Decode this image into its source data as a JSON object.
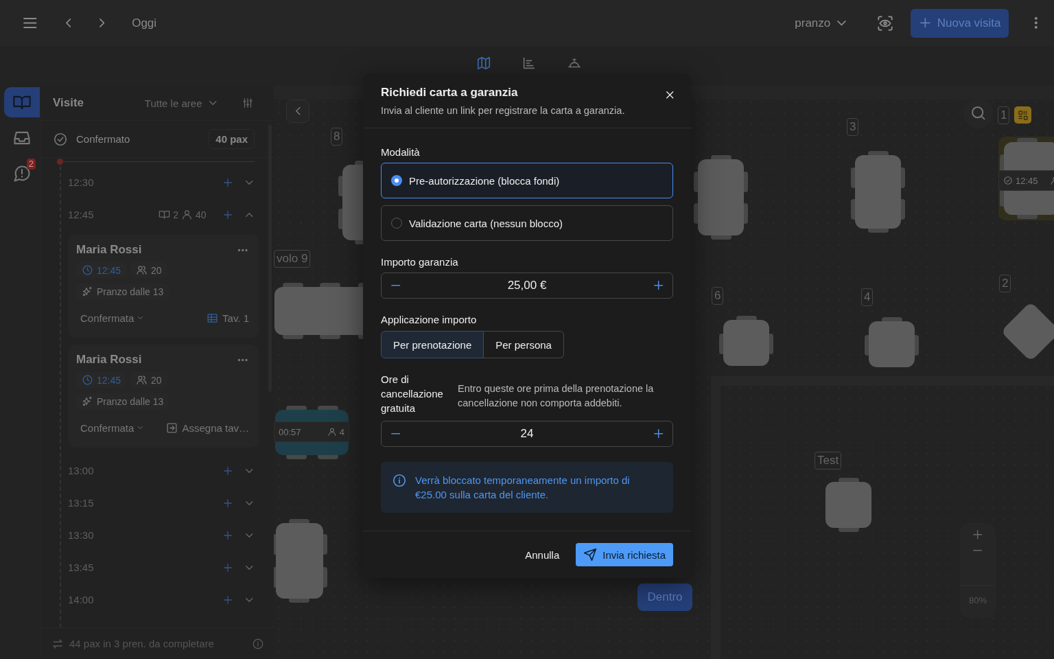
{
  "top_bar": {
    "date_label": "Oggi",
    "service": "pranzo",
    "new_visit_button": "Nuova visita"
  },
  "view_tabs": [
    {
      "selected": true
    },
    {
      "selected": false
    },
    {
      "selected": false
    }
  ],
  "rail": [
    {
      "selected": true
    },
    {
      "selected": false
    },
    {
      "selected": false,
      "badge": "2"
    }
  ],
  "sidebar": {
    "title": "Visite",
    "area_filter": "Tutte le aree",
    "status": "Confermato",
    "pax": "40 pax",
    "slots": [
      {
        "time": "12:30",
        "expanded": false
      },
      {
        "time": "12:45",
        "expanded": true,
        "bookings": "2",
        "guests": "40",
        "visits": [
          {
            "name": "Maria Rossi",
            "time": "12:45",
            "guests": "20",
            "tag": "Pranzo dalle 13",
            "status": "Confermata",
            "table": {
              "kind": "assigned",
              "label": "Tav. 1"
            }
          },
          {
            "name": "Maria Rossi",
            "time": "12:45",
            "guests": "20",
            "tag": "Pranzo dalle 13",
            "status": "Confermata",
            "table": {
              "kind": "unassigned",
              "label": "Assegna tav…"
            }
          }
        ]
      },
      {
        "time": "13:00",
        "expanded": false
      },
      {
        "time": "13:15",
        "expanded": false
      },
      {
        "time": "13:30",
        "expanded": false
      },
      {
        "time": "13:45",
        "expanded": false
      },
      {
        "time": "14:00",
        "expanded": false
      }
    ],
    "footer": "44 pax in 3 pren. da completare"
  },
  "floor": {
    "table_count": "1",
    "tables": [
      {
        "label": "8",
        "selected": false,
        "occupied": false
      },
      {
        "label": "volo 9",
        "selected": false,
        "occupied": false
      },
      {
        "selected": false,
        "occupied": true,
        "timer": "00:57",
        "guests": "4"
      },
      {
        "selected": false,
        "occupied": false
      },
      {
        "selected": false,
        "occupied": false
      },
      {
        "label": "3",
        "selected": false,
        "occupied": false
      },
      {
        "selected": true,
        "occupied": false,
        "time": "12:45"
      },
      {
        "label": "6",
        "selected": false,
        "occupied": false
      },
      {
        "label": "4",
        "selected": false,
        "occupied": false
      },
      {
        "label": "2",
        "selected": false,
        "occupied": false
      },
      {
        "label": "Test",
        "selected": false,
        "occupied": false
      }
    ],
    "zoom": "80%",
    "area_button": "Dentro"
  },
  "dialog": {
    "title": "Richiedi carta a garanzia",
    "subtitle": "Invia al cliente un link per registrare la carta a garanzia.",
    "mode_label": "Modalità",
    "modes": [
      {
        "label": "Pre-autorizzazione (blocca fondi)",
        "selected": true
      },
      {
        "label": "Validazione carta (nessun blocco)",
        "selected": false
      }
    ],
    "amount_label": "Importo garanzia",
    "amount": "25,00 €",
    "apply_label": "Applicazione importo",
    "apply_options": [
      {
        "label": "Per prenotazione",
        "selected": true
      },
      {
        "label": "Per persona",
        "selected": false
      }
    ],
    "hours_label": "Ore di cancellazione gratuita",
    "hours_hint": "Entro queste ore prima della prenotazione la cancellazione non comporta addebiti.",
    "hours": "24",
    "info": "Verrà bloccato temporaneamente un importo di €25.00 sulla carta del cliente.",
    "cancel_button": "Annulla",
    "submit_button": "Invia richiesta"
  }
}
